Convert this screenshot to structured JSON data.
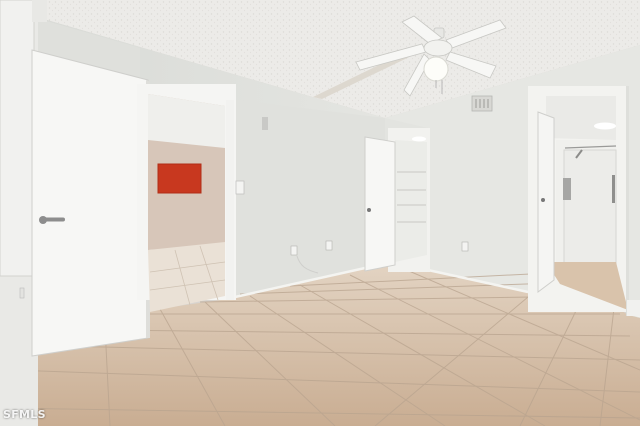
{
  "photo": {
    "watermark": "SFMLS"
  }
}
